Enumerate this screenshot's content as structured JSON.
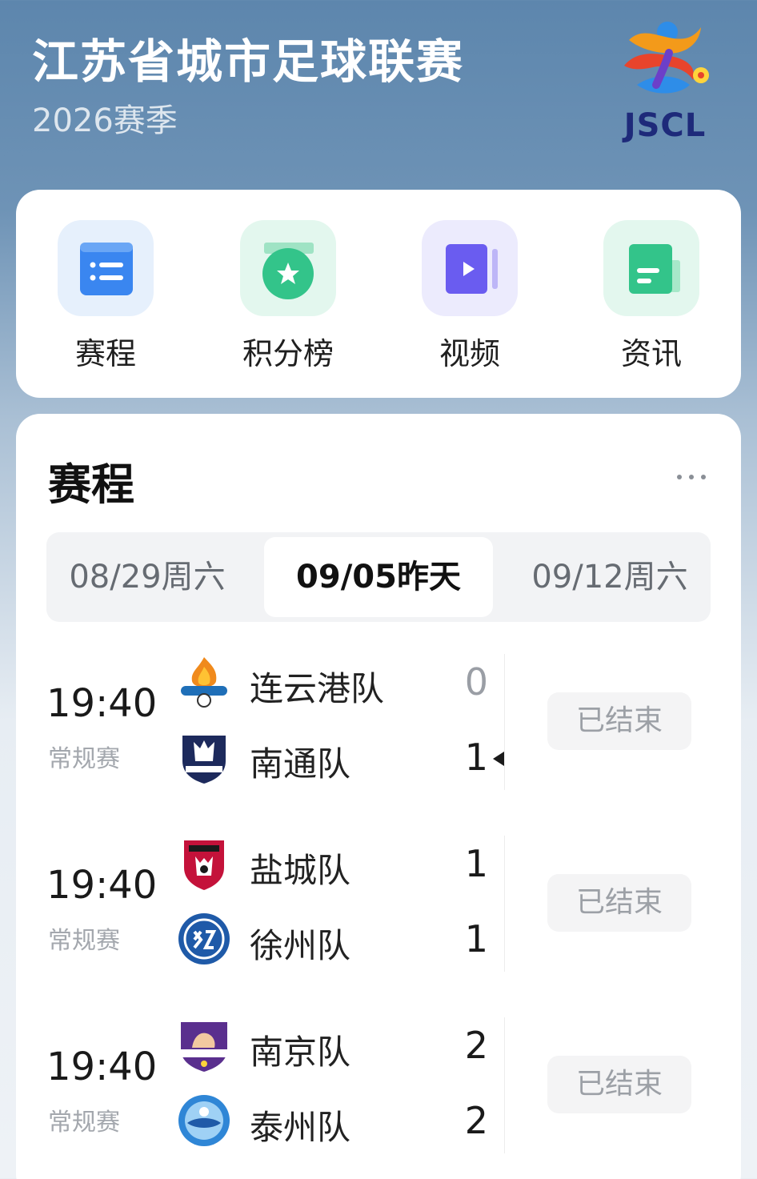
{
  "header": {
    "title": "江苏省城市足球联赛",
    "season": "2026赛季",
    "logo_text": "JSCL"
  },
  "quick_nav": [
    {
      "label": "赛程",
      "icon": "schedule-list-icon",
      "color": "#3a86f0"
    },
    {
      "label": "积分榜",
      "icon": "standings-medal-icon",
      "color": "#33c48a"
    },
    {
      "label": "视频",
      "icon": "video-play-icon",
      "color": "#6a5cf0"
    },
    {
      "label": "资讯",
      "icon": "news-document-icon",
      "color": "#33c48a"
    }
  ],
  "schedule": {
    "title": "赛程",
    "more_icon": "more-dots-icon",
    "dates": [
      {
        "label": "08/29周六",
        "active": false
      },
      {
        "label": "09/05昨天",
        "active": true
      },
      {
        "label": "09/12周六",
        "active": false
      }
    ],
    "matches": [
      {
        "time": "19:40",
        "type": "常规赛",
        "status": "已结束",
        "home": {
          "name": "连云港队",
          "score": "0",
          "winner": false
        },
        "away": {
          "name": "南通队",
          "score": "1",
          "winner": true
        }
      },
      {
        "time": "19:40",
        "type": "常规赛",
        "status": "已结束",
        "home": {
          "name": "盐城队",
          "score": "1",
          "winner": false
        },
        "away": {
          "name": "徐州队",
          "score": "1",
          "winner": false
        }
      },
      {
        "time": "19:40",
        "type": "常规赛",
        "status": "已结束",
        "home": {
          "name": "南京队",
          "score": "2",
          "winner": false
        },
        "away": {
          "name": "泰州队",
          "score": "2",
          "winner": false
        }
      }
    ]
  }
}
